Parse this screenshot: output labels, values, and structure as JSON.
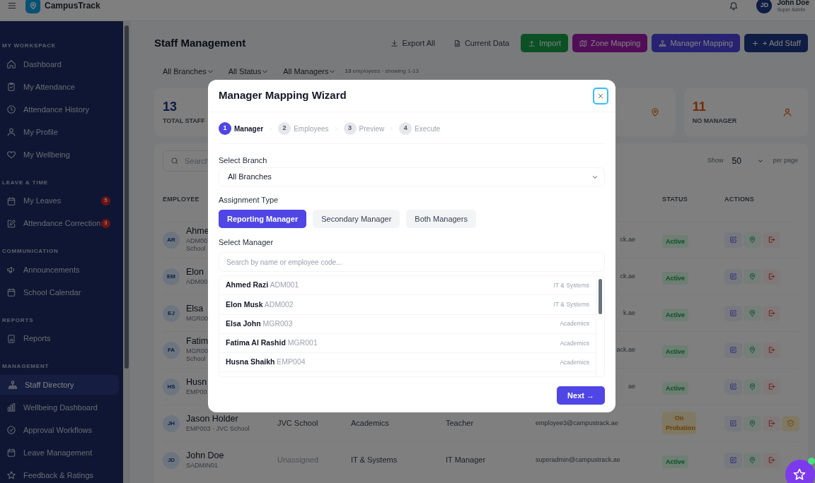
{
  "top_bar": {
    "app_name": "CampusTrack",
    "user_initials": "JD",
    "user_name": "John Doe",
    "user_role": "Super Admin"
  },
  "sidebar": {
    "sections": [
      {
        "title": "MY WORKSPACE",
        "items": [
          {
            "label": "Dashboard",
            "selected": false
          },
          {
            "label": "My Attendance",
            "selected": false
          },
          {
            "label": "Attendance History",
            "selected": false
          },
          {
            "label": "My Profile",
            "selected": false
          },
          {
            "label": "My Wellbeing",
            "selected": false
          }
        ]
      },
      {
        "title": "LEAVE & TIME",
        "items": [
          {
            "label": "My Leaves",
            "selected": false,
            "badge": "5"
          },
          {
            "label": "Attendance Correction",
            "selected": false,
            "badge": "3"
          }
        ]
      },
      {
        "title": "COMMUNICATION",
        "items": [
          {
            "label": "Announcements",
            "selected": false
          },
          {
            "label": "School Calendar",
            "selected": false
          }
        ]
      },
      {
        "title": "REPORTS",
        "items": [
          {
            "label": "Reports",
            "selected": false
          }
        ]
      },
      {
        "title": "MANAGEMENT",
        "items": [
          {
            "label": "Staff Directory",
            "selected": true
          },
          {
            "label": "Wellbeing Dashboard",
            "selected": false
          },
          {
            "label": "Approval Workflows",
            "selected": false
          },
          {
            "label": "Leave Management",
            "selected": false
          },
          {
            "label": "Feedback & Ratings",
            "selected": false
          }
        ]
      }
    ]
  },
  "page": {
    "title": "Staff Management",
    "actions": [
      {
        "label": "Export All",
        "kind": "plain"
      },
      {
        "label": "Current Data",
        "kind": "plain"
      },
      {
        "label": "Import",
        "kind": "import"
      },
      {
        "label": "Zone Mapping",
        "kind": "zone"
      },
      {
        "label": "Manager Mapping",
        "kind": "manager"
      },
      {
        "label": "+ Add Staff",
        "kind": "add"
      }
    ]
  },
  "filters": [
    {
      "label": "All Branches"
    },
    {
      "label": "All Status"
    },
    {
      "label": "All Managers"
    }
  ],
  "summary": "**13** employees · showing 1-13",
  "stats": [
    {
      "kind": "total",
      "value": "13",
      "label": "TOTAL STAFF"
    },
    {
      "kind": "zone"
    },
    {
      "kind": "no_manager",
      "value": "11",
      "label": "NO MANAGER"
    }
  ],
  "search": {
    "placeholder": "Search"
  },
  "page_size": {
    "label": "Show",
    "value": "50",
    "suffix": "per page"
  },
  "table": {
    "columns": [
      {
        "label": "EMPLOYEE",
        "kind": "employee"
      },
      {
        "label": "STATUS",
        "kind": "status"
      },
      {
        "label": "ACTIONS",
        "kind": "actions"
      }
    ],
    "rows": [
      {
        "kind": "partial",
        "initials": "AR",
        "name": "Ahme",
        "sub": "ADM00",
        "sub2": "School",
        "email": "ck.ae",
        "status": {
          "text": "Active",
          "kind": "active"
        },
        "extra_action": false
      },
      {
        "kind": "partial",
        "initials": "EM",
        "name": "Elon",
        "sub": "ADM00",
        "email": "ck.ae",
        "status": {
          "text": "Active",
          "kind": "active"
        },
        "extra_action": false
      },
      {
        "kind": "partial",
        "initials": "EJ",
        "name": "Elsa",
        "sub": "MGR00",
        "email": "k.ae",
        "status": {
          "text": "Active",
          "kind": "active"
        },
        "extra_action": false
      },
      {
        "kind": "partial",
        "initials": "FA",
        "name": "Fatim",
        "sub": "MGR00",
        "sub2": "School",
        "email": "ack.ae",
        "status": {
          "text": "Active",
          "kind": "active"
        },
        "extra_action": false
      },
      {
        "kind": "partial",
        "initials": "HS",
        "name": "Husn",
        "sub": "EMP00",
        "email": "ae",
        "status": {
          "text": "Active",
          "kind": "active"
        },
        "extra_action": false
      },
      {
        "kind": "full",
        "initials": "JH",
        "name": "Jason Holder",
        "sub": "EMP003 · JVC School",
        "branch": "JVC School",
        "branch_assigned": true,
        "department": "Academics",
        "role": "Teacher",
        "email": "employee3@campustrack.ae",
        "status": {
          "text": "On Probation",
          "kind": "probation"
        },
        "extra_action": true
      },
      {
        "kind": "full",
        "initials": "JD",
        "name": "John Doe",
        "sub": "SADMIN01",
        "branch": "Unassigned",
        "branch_assigned": false,
        "department": "IT & Systems",
        "role": "IT Manager",
        "email": "superadmin@campustrack.ae",
        "status": {
          "text": "Active",
          "kind": "active"
        },
        "extra_action": false
      }
    ]
  },
  "dialog": {
    "title": "Manager Mapping Wizard",
    "steps": [
      {
        "number": "1",
        "label": "Manager",
        "selected": true
      },
      {
        "number": "2",
        "label": "Employees",
        "selected": false
      },
      {
        "number": "3",
        "label": "Preview",
        "selected": false
      },
      {
        "number": "4",
        "label": "Execute",
        "selected": false
      }
    ],
    "branch": {
      "label": "Select Branch",
      "value": "All Branches"
    },
    "assignment": {
      "label": "Assignment Type",
      "options": [
        {
          "label": "Reporting Manager",
          "selected": true
        },
        {
          "label": "Secondary Manager",
          "selected": false
        },
        {
          "label": "Both Managers",
          "selected": false
        }
      ]
    },
    "manager": {
      "label": "Select Manager",
      "placeholder": "Search by name or employee code...",
      "options": [
        {
          "name": "Ahmed Razi",
          "code": "ADM001",
          "department": "IT & Systems"
        },
        {
          "name": "Elon Musk",
          "code": "ADM002",
          "department": "IT & Systems"
        },
        {
          "name": "Elsa John",
          "code": "MGR003",
          "department": "Academics"
        },
        {
          "name": "Fatima Al Rashid",
          "code": "MGR001",
          "department": "Academics"
        },
        {
          "name": "Husna Shaikh",
          "code": "EMP004",
          "department": "Academics"
        }
      ]
    },
    "next_button": "Next →"
  }
}
